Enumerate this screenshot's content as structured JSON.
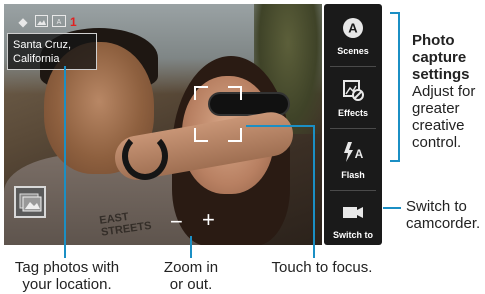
{
  "status": {
    "shots_remaining": "1",
    "icons": [
      "geotag-icon",
      "image-size-icon",
      "scene-mode-icon"
    ]
  },
  "location_tag": {
    "line1": "Santa Cruz,",
    "line2": "California"
  },
  "zoom": {
    "minus": "−",
    "plus": "+"
  },
  "shirt_text": {
    "line1": "EAST",
    "line2": "STREETS"
  },
  "side_panel": {
    "buttons": [
      {
        "label": "Scenes",
        "icon": "scene-a-icon"
      },
      {
        "label": "Effects",
        "icon": "effects-icon"
      },
      {
        "label": "Flash",
        "icon": "flash-auto-icon"
      },
      {
        "label": "Switch to",
        "icon": "camcorder-icon"
      }
    ]
  },
  "callouts": {
    "settings_title_1": "Photo",
    "settings_title_2": "capture",
    "settings_title_3": "settings",
    "settings_body_1": "Adjust for",
    "settings_body_2": "greater",
    "settings_body_3": "creative",
    "settings_body_4": "control.",
    "switch_line1": "Switch to",
    "switch_line2": "camcorder.",
    "tag_line1": "Tag photos with",
    "tag_line2": "your location.",
    "zoom_line1": "Zoom in",
    "zoom_line2": "or out.",
    "focus": "Touch to focus."
  },
  "colors": {
    "leader_line": "#1b8fc4",
    "shots_count": "#e02020",
    "panel_bg": "#1a1a1a"
  }
}
